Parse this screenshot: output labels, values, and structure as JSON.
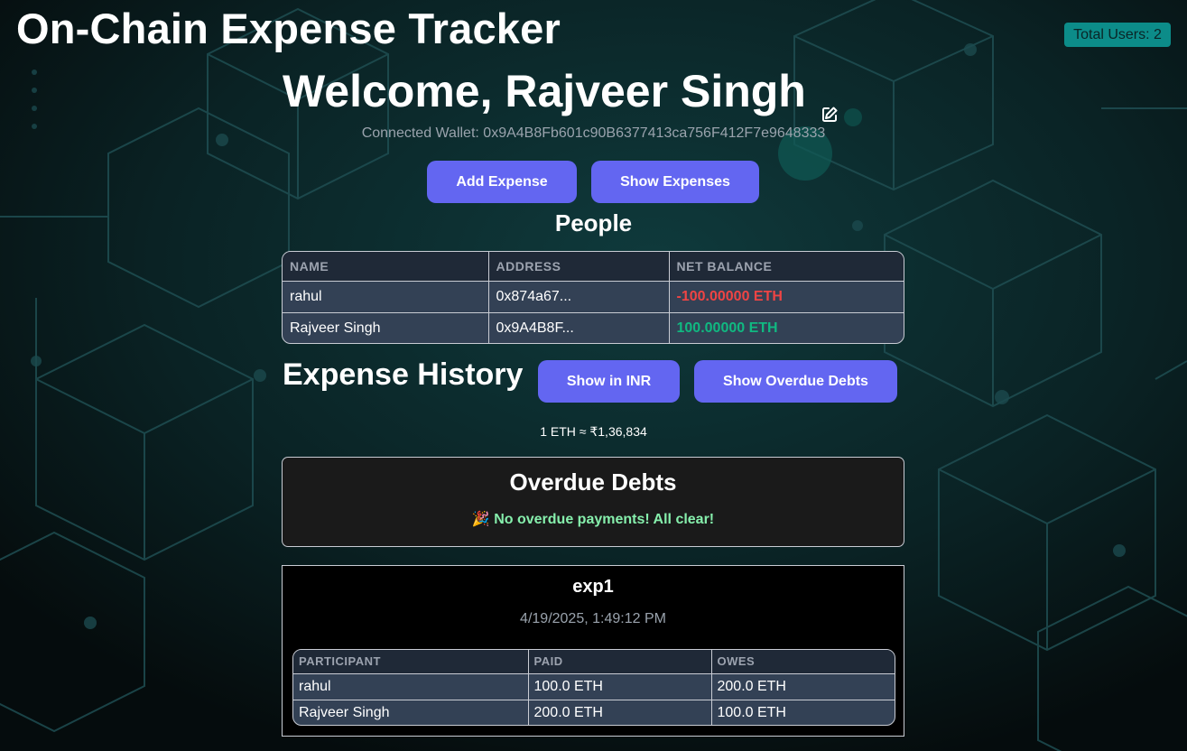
{
  "app_title": "On-Chain Expense Tracker",
  "total_users": "Total Users: 2",
  "welcome": "Welcome, Rajveer Singh",
  "wallet": "Connected Wallet: 0x9A4B8Fb601c90B6377413ca756F412F7e9648333",
  "buttons": {
    "add_expense": "Add Expense",
    "show_expenses": "Show Expenses",
    "show_inr": "Show in INR",
    "show_overdue": "Show Overdue Debts"
  },
  "people": {
    "title": "People",
    "headers": [
      "NAME",
      "ADDRESS",
      "NET BALANCE"
    ],
    "rows": [
      {
        "name": "rahul",
        "address": "0x874a67...",
        "balance": "-100.00000 ETH"
      },
      {
        "name": "Rajveer Singh",
        "address": "0x9A4B8F...",
        "balance": "100.00000 ETH"
      }
    ]
  },
  "history": {
    "title": "Expense History",
    "rate": "1 ETH ≈ ₹1,36,834"
  },
  "overdue": {
    "title": "Overdue Debts",
    "message": "🎉 No overdue payments! All clear!"
  },
  "expense": {
    "name": "exp1",
    "date": "4/19/2025, 1:49:12 PM",
    "headers": [
      "PARTICIPANT",
      "PAID",
      "OWES"
    ],
    "rows": [
      {
        "participant": "rahul",
        "paid": "100.0 ETH",
        "owes": "200.0 ETH"
      },
      {
        "participant": "Rajveer Singh",
        "paid": "200.0 ETH",
        "owes": "100.0 ETH"
      }
    ]
  },
  "colors": {
    "accent": "#6366f1",
    "badge": "#0c8c89",
    "negative": "#ef4444",
    "positive": "#10b981",
    "success_text": "#86efac"
  }
}
